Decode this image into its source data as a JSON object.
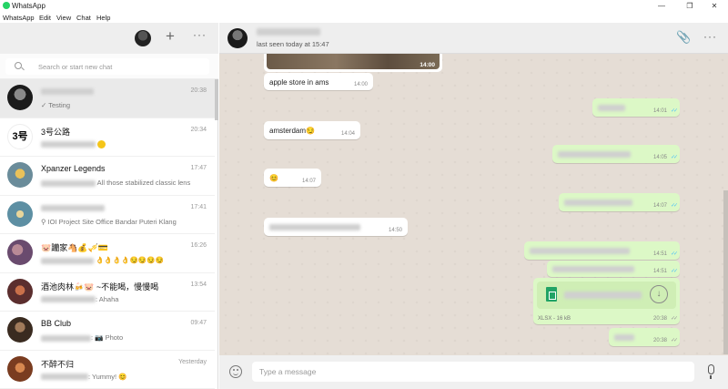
{
  "window": {
    "title": "WhatsApp",
    "min_glyph": "—",
    "max_glyph": "❐",
    "close_glyph": "✕"
  },
  "menu": [
    "WhatsApp",
    "Edit",
    "View",
    "Chat",
    "Help"
  ],
  "left_header": {
    "new_chat_glyph": "+",
    "menu_glyph": "···"
  },
  "search": {
    "placeholder": "Search or start new chat"
  },
  "chats": [
    {
      "name": "",
      "time": "20:38",
      "message": "✓ Testing",
      "avatar_color": "#1b1b1b"
    },
    {
      "name": "3号公路",
      "time": "20:34",
      "message": "",
      "avatar_color": "#f4f4f4"
    },
    {
      "name": "Xpanzer Legends",
      "time": "17:47",
      "message": "All those stabilized classic lens",
      "avatar_color": "#6a8c9a"
    },
    {
      "name": "",
      "time": "17:41",
      "message": "IOI Project Site Office Bandar Puteri Klang",
      "avatar_color": "#5d8fa3"
    },
    {
      "name": "🐷躪家🐴💰🎺💳",
      "time": "16:26",
      "message": "👌👌👌👌😏😏😏😏",
      "avatar_color": "#6a4b6e"
    },
    {
      "name": "酒池肉林🍻🐷 ~不能喝，慢慢喝",
      "time": "13:54",
      "message": ": Ahaha",
      "avatar_color": "#5b2e2e"
    },
    {
      "name": "BB Club",
      "time": "09:47",
      "message": ": 📷 Photo",
      "avatar_color": "#3a2b20"
    },
    {
      "name": "不醉不归",
      "time": "Yesterday",
      "message": ": Yummy! 😊",
      "avatar_color": "#7a3c20"
    }
  ],
  "conversation": {
    "status": "last seen today at 15:47",
    "attach_glyph": "📎",
    "menu_glyph": "···",
    "image_time": "14:00",
    "messages": [
      {
        "dir": "in",
        "text": "apple store in ams",
        "time": "14:00"
      },
      {
        "dir": "out",
        "text": "",
        "time": "14:01"
      },
      {
        "dir": "in",
        "text": "amsterdam😏",
        "time": "14:04"
      },
      {
        "dir": "out",
        "text": "",
        "time": "14:05"
      },
      {
        "dir": "in",
        "text": "😊",
        "time": "14:07"
      },
      {
        "dir": "out",
        "text": "",
        "time": "14:07"
      },
      {
        "dir": "in",
        "text": "",
        "time": "14:50"
      },
      {
        "dir": "out",
        "text": "",
        "time": "14:51"
      },
      {
        "dir": "out",
        "text": "",
        "time": "14:51"
      },
      {
        "dir": "out",
        "text": "",
        "time": "20:38"
      }
    ],
    "file": {
      "meta": "XLSX - 16 kB",
      "time": "20:38",
      "download_glyph": "↓"
    },
    "checks": "✓✓"
  },
  "composer": {
    "placeholder": "Type a message"
  },
  "colors": {
    "outgoing_bubble": "#dcf8c6",
    "chat_background": "#e5ddd5",
    "read_tick": "#4fc3f7",
    "brand": "#25d366"
  }
}
